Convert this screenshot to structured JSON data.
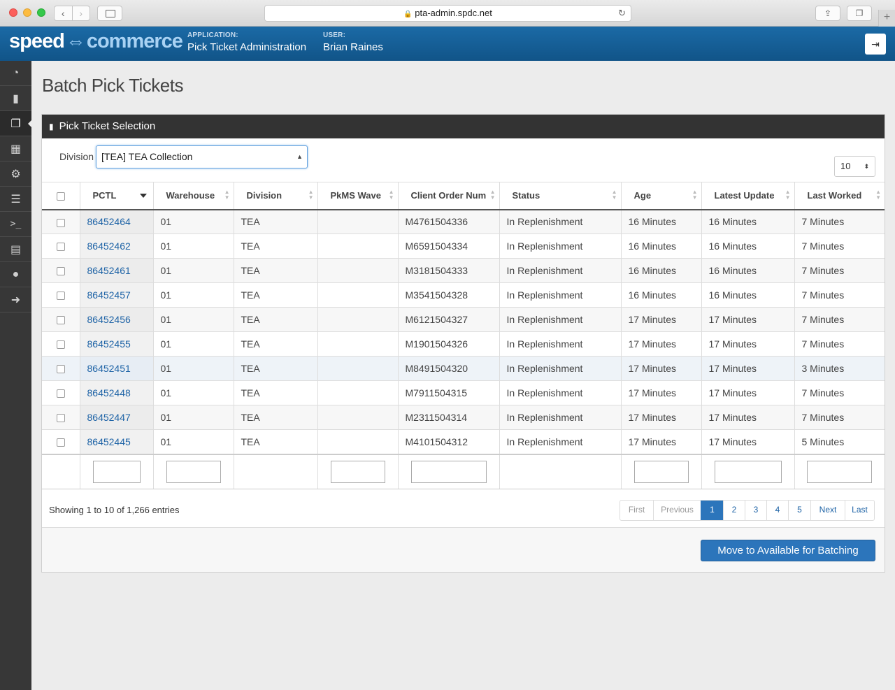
{
  "browser": {
    "url": "pta-admin.spdc.net"
  },
  "header": {
    "logo": {
      "speed": "speed",
      "arrow": "⇔",
      "commerce": "commerce"
    },
    "application_label": "APPLICATION:",
    "application_value": "Pick Ticket Administration",
    "user_label": "USER:",
    "user_value": "Brian Raines"
  },
  "leftnav": {
    "icons": [
      "dashboard-icon",
      "file-icon",
      "files-icon",
      "building-icon",
      "cogs-icon",
      "server-icon",
      "terminal-icon",
      "document-icon",
      "user-icon",
      "arrow-circle-right-icon"
    ],
    "active_index": 2
  },
  "page": {
    "title": "Batch Pick Tickets"
  },
  "panel": {
    "title": "Pick Ticket Selection",
    "division_label": "Division",
    "division_value": "[TEA] TEA Collection",
    "page_length": "10"
  },
  "table": {
    "columns": [
      "PCTL",
      "Warehouse",
      "Division",
      "PkMS Wave",
      "Client Order Num",
      "Status",
      "Age",
      "Latest Update",
      "Last Worked"
    ],
    "rows": [
      {
        "pctl": "86452464",
        "warehouse": "01",
        "division": "TEA",
        "wave": "",
        "order": "M4761504336",
        "status": "In Replenishment",
        "age": "16 Minutes",
        "latest": "16 Minutes",
        "worked": "7 Minutes"
      },
      {
        "pctl": "86452462",
        "warehouse": "01",
        "division": "TEA",
        "wave": "",
        "order": "M6591504334",
        "status": "In Replenishment",
        "age": "16 Minutes",
        "latest": "16 Minutes",
        "worked": "7 Minutes"
      },
      {
        "pctl": "86452461",
        "warehouse": "01",
        "division": "TEA",
        "wave": "",
        "order": "M3181504333",
        "status": "In Replenishment",
        "age": "16 Minutes",
        "latest": "16 Minutes",
        "worked": "7 Minutes"
      },
      {
        "pctl": "86452457",
        "warehouse": "01",
        "division": "TEA",
        "wave": "",
        "order": "M3541504328",
        "status": "In Replenishment",
        "age": "16 Minutes",
        "latest": "16 Minutes",
        "worked": "7 Minutes"
      },
      {
        "pctl": "86452456",
        "warehouse": "01",
        "division": "TEA",
        "wave": "",
        "order": "M6121504327",
        "status": "In Replenishment",
        "age": "17 Minutes",
        "latest": "17 Minutes",
        "worked": "7 Minutes"
      },
      {
        "pctl": "86452455",
        "warehouse": "01",
        "division": "TEA",
        "wave": "",
        "order": "M1901504326",
        "status": "In Replenishment",
        "age": "17 Minutes",
        "latest": "17 Minutes",
        "worked": "7 Minutes"
      },
      {
        "pctl": "86452451",
        "warehouse": "01",
        "division": "TEA",
        "wave": "",
        "order": "M8491504320",
        "status": "In Replenishment",
        "age": "17 Minutes",
        "latest": "17 Minutes",
        "worked": "3 Minutes"
      },
      {
        "pctl": "86452448",
        "warehouse": "01",
        "division": "TEA",
        "wave": "",
        "order": "M7911504315",
        "status": "In Replenishment",
        "age": "17 Minutes",
        "latest": "17 Minutes",
        "worked": "7 Minutes"
      },
      {
        "pctl": "86452447",
        "warehouse": "01",
        "division": "TEA",
        "wave": "",
        "order": "M2311504314",
        "status": "In Replenishment",
        "age": "17 Minutes",
        "latest": "17 Minutes",
        "worked": "7 Minutes"
      },
      {
        "pctl": "86452445",
        "warehouse": "01",
        "division": "TEA",
        "wave": "",
        "order": "M4101504312",
        "status": "In Replenishment",
        "age": "17 Minutes",
        "latest": "17 Minutes",
        "worked": "5 Minutes"
      }
    ]
  },
  "footer": {
    "info": "Showing 1 to 10 of 1,266 entries",
    "pager": {
      "first": "First",
      "previous": "Previous",
      "pages": [
        "1",
        "2",
        "3",
        "4",
        "5"
      ],
      "current": "1",
      "next": "Next",
      "last": "Last"
    },
    "move_button": "Move to Available for Batching"
  },
  "colors": {
    "header_blue": "#115488",
    "accent": "#2c75bb",
    "link": "#1e63a6",
    "nav_dark": "#373737",
    "panel_header": "#333333"
  }
}
